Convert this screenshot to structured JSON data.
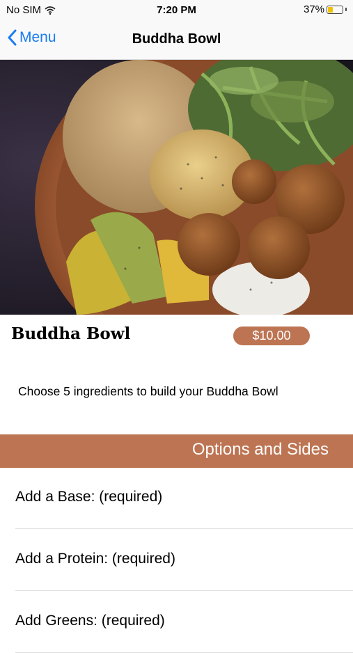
{
  "status_bar": {
    "carrier": "No SIM",
    "time": "7:20 PM",
    "battery_percent": "37%",
    "battery_level": 0.37,
    "battery_color": "#f2c100"
  },
  "nav": {
    "back_label": "Menu",
    "title": "Buddha Bowl",
    "tint_color": "#1a7cf2"
  },
  "item": {
    "name": "Buddha Bowl",
    "price": "$10.00",
    "description": "Choose 5 ingredients to build your Buddha Bowl"
  },
  "options_section": {
    "header": "Options and Sides",
    "accent_color": "#bd7452",
    "rows": [
      {
        "label": "Add a Base: (required)"
      },
      {
        "label": "Add a Protein: (required)"
      },
      {
        "label": "Add Greens: (required)"
      }
    ]
  }
}
